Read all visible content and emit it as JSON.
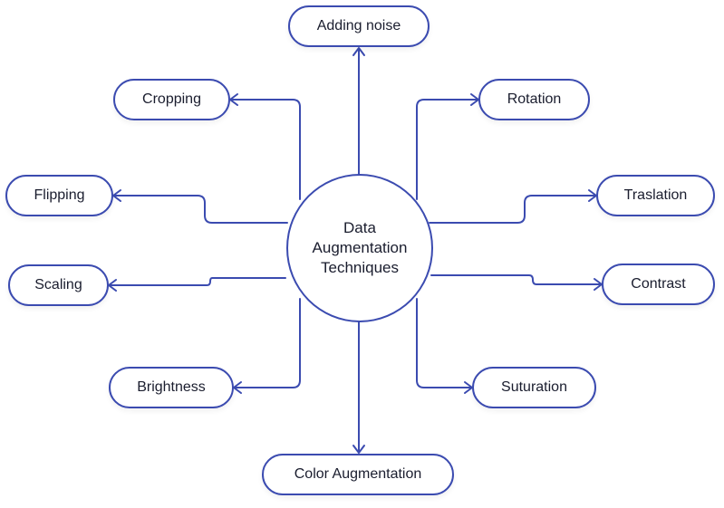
{
  "diagram": {
    "center": {
      "lines": [
        "Data",
        "Augmentation",
        "Techniques"
      ]
    },
    "nodes": {
      "adding_noise": "Adding noise",
      "cropping": "Cropping",
      "rotation": "Rotation",
      "flipping": "Flipping",
      "traslation": "Traslation",
      "scaling": "Scaling",
      "contrast": "Contrast",
      "brightness": "Brightness",
      "suturation": "Suturation",
      "color_augmentation": "Color Augmentation"
    },
    "edge_color": "#3b4bb0"
  }
}
